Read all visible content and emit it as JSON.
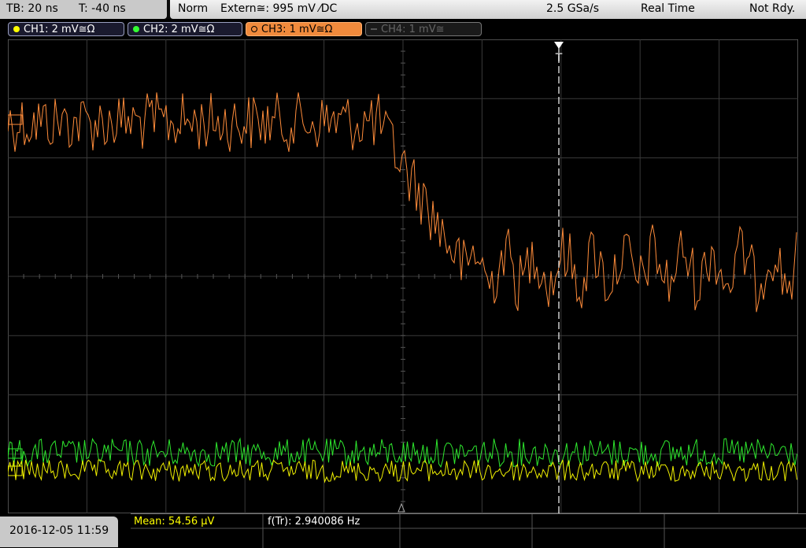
{
  "topbar": {
    "timebase": "TB: 20 ns",
    "trigger_offset": "T: -40 ns",
    "trigger_mode": "Norm",
    "trigger_source": "Extern≅: 995 mV ⁄DC",
    "sample_rate": "2.5 GSa/s",
    "acq_mode": "Real Time",
    "status": "Not Rdy."
  },
  "channels": [
    {
      "label": "CH1: 2 mV≅Ω",
      "color": "#ffff00",
      "state": "inactive-tab"
    },
    {
      "label": "CH2: 2 mV≅Ω",
      "color": "#33ff33",
      "state": "inactive-tab"
    },
    {
      "label": "CH3: 1 mV≅Ω",
      "color": "#ff8c3a",
      "state": "active"
    },
    {
      "label": "CH4: 1 mV≅",
      "color": "#666666",
      "state": "off"
    }
  ],
  "trigger_marker": "T",
  "bottombar": {
    "datetime": "2016-12-05 11:59",
    "meas1": "Mean: 54.56 µV",
    "meas2": "f(Tr): 2.940086 Hz"
  }
}
